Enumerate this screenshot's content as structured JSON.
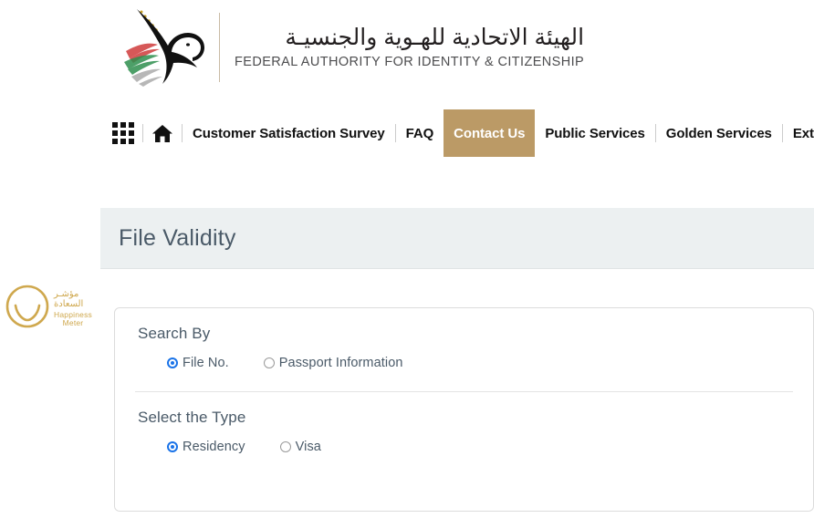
{
  "header": {
    "logo": {
      "icon": "uae-falcon-logo-icon",
      "arabic_title": "الهيئة الاتحادية للهـوية والجنسيـة",
      "english_title": "FEDERAL AUTHORITY FOR IDENTITY & CITIZENSHIP"
    }
  },
  "nav": {
    "apps_icon": "grid-apps-icon",
    "home_icon": "home-icon",
    "active_color": "#bb9a66",
    "items": [
      {
        "label": "Customer Satisfaction Survey",
        "active": false
      },
      {
        "label": "FAQ",
        "active": false
      },
      {
        "label": "Contact Us",
        "active": true
      },
      {
        "label": "Public Services",
        "active": false
      },
      {
        "label": "Golden Services",
        "active": false
      },
      {
        "label": "Extend visa s",
        "active": false
      }
    ]
  },
  "title_band": {
    "page_title": "File Validity",
    "background": "#ecf0f1"
  },
  "happiness_meter": {
    "icon": "happiness-smile-icon",
    "arabic_line1": "مؤشـر",
    "arabic_line2": "السعادة",
    "english_line1": "Happiness",
    "english_line2": "Meter",
    "color": "#cfa84e"
  },
  "form": {
    "search_by": {
      "label": "Search By",
      "options": [
        {
          "label": "File No.",
          "selected": true
        },
        {
          "label": "Passport Information",
          "selected": false
        }
      ]
    },
    "select_type": {
      "label": "Select the Type",
      "options": [
        {
          "label": "Residency",
          "selected": true
        },
        {
          "label": "Visa",
          "selected": false
        }
      ]
    },
    "radio_selected_color": "#1a73e8"
  }
}
